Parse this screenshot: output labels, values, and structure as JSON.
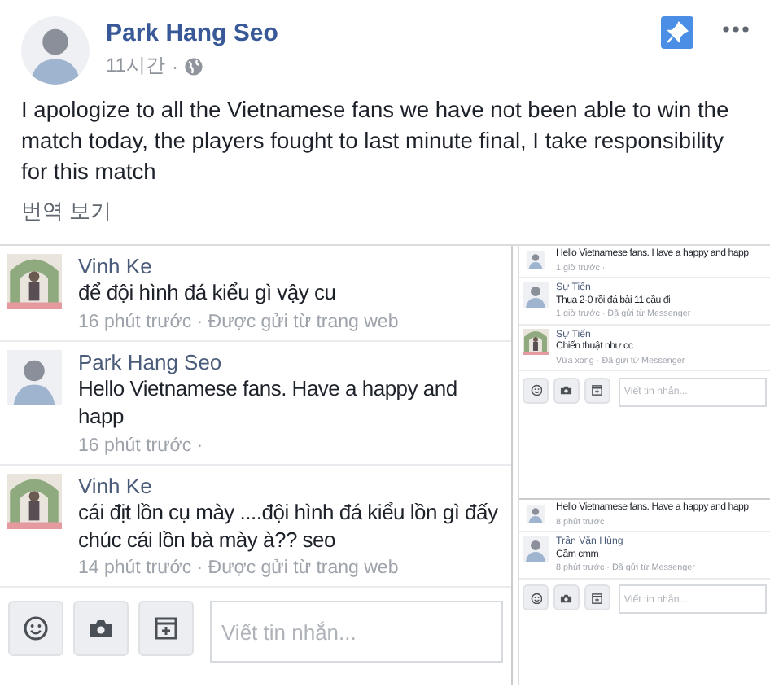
{
  "post": {
    "author": "Park Hang Seo",
    "time": "11시간",
    "separator": "·",
    "text": "I apologize to all the Vietnamese fans we have not been able to win the match today, the players fought to last minute final, I take responsibility for this match",
    "translate_link": "번역 보기"
  },
  "chat_panels": [
    {
      "messages": [
        {
          "sender": "Vinh Ke",
          "text": "để đội hình đá kiểu gì vậy cu",
          "meta": "16 phút trước · Được gửi từ trang web"
        },
        {
          "sender": "Park Hang Seo",
          "text": "Hello Vietnamese fans. Have a happy and happ",
          "meta": "16 phút trước ·"
        },
        {
          "sender": "Vinh Ke",
          "text": "cái địt lồn cụ mày ....đội hình đá kiểu lồn gì đấy chúc cái lồn bà mày à?? seo",
          "meta": "14 phút trước · Được gửi từ trang web"
        }
      ],
      "composer": {
        "placeholder": "Viết tin nhắn..."
      }
    },
    {
      "messages": [
        {
          "text": "Hello Vietnamese fans. Have a happy and happ",
          "meta": "1 giờ trước ·"
        },
        {
          "sender": "Sự Tiến",
          "text": "Thua 2-0 rồi đá bài 11 cầu đi",
          "meta": "1 giờ trước · Đã gửi từ Messenger"
        },
        {
          "sender": "Sự Tiến",
          "text": "Chiến thuật như cc",
          "meta": "Vừa xong · Đã gửi từ Messenger"
        }
      ],
      "composer": {
        "placeholder": "Viết tin nhắn..."
      }
    },
    {
      "messages": [
        {
          "text": "Hello Vietnamese fans. Have a happy and happ",
          "meta": "8 phút trước"
        },
        {
          "sender": "Trần Văn Hùng",
          "text": "Cầm cmm",
          "meta": "8 phút trước · Đã gửi từ Messenger"
        }
      ],
      "composer": {
        "placeholder": "Viết tin nhắn..."
      }
    }
  ]
}
